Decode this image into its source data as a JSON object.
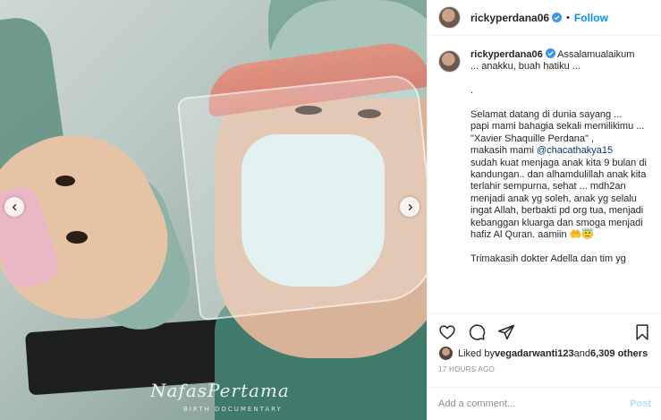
{
  "photo": {
    "watermark_title": "NafasPertama",
    "watermark_subtitle": "BIRTH DOCUMENTARY"
  },
  "header": {
    "username": "rickyperdana06",
    "separator": "•",
    "follow_label": "Follow"
  },
  "caption": {
    "username": "rickyperdana06",
    "text_1": " Assalamualaikum\n... anakku, buah hatiku ...\n\n.\n\nSelamat datang di dunia sayang ...\npapi mami bahagia sekali memilikimu ...\n\"Xavier Shaquille Perdana\" ,\nmakasih mami ",
    "mention": "@chacathakya15",
    "text_2": "\nsudah kuat menjaga anak kita 9 bulan di kandungan.. dan alhamdulillah anak kita terlahir sempurna, sehat ... mdh2an menjadi anak yg soleh, anak yg selalu ingat Allah, berbakti pd org tua, menjadi kebanggan kluarga dan smoga menjadi hafiz Al Quran. aamiin 🤲😇\n\nTrimakasih dokter Adella dan tim yg"
  },
  "likes": {
    "prefix": "Liked by ",
    "user": "vegadarwanti123",
    "middle": " and ",
    "count": "6,309 others"
  },
  "timestamp": "17 HOURS AGO",
  "comment_box": {
    "placeholder": "Add a comment...",
    "post_label": "Post"
  },
  "colors": {
    "accent": "#0095f6",
    "verified": "#3897f0",
    "post_disabled": "#b2dffc"
  },
  "icons": [
    "chevron-left-icon",
    "chevron-right-icon",
    "verified-badge-icon",
    "heart-icon",
    "comment-icon",
    "share-icon",
    "bookmark-icon"
  ]
}
